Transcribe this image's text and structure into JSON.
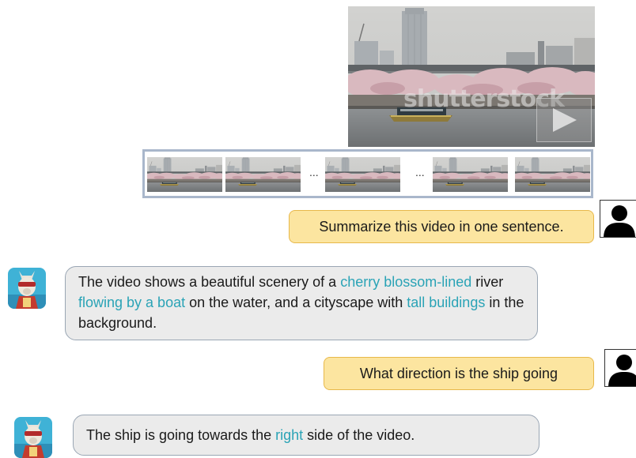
{
  "video": {
    "watermark": "shutterstock",
    "play_icon": "play-icon"
  },
  "frame_strip": {
    "ellipsis_1": "...",
    "ellipsis_2": "..."
  },
  "chat": {
    "turns": [
      {
        "role": "user",
        "text": "Summarize this video in one sentence."
      },
      {
        "role": "assistant",
        "segments": [
          {
            "text": "The video shows a beautiful scenery of a ",
            "highlight": false
          },
          {
            "text": "cherry blossom-lined",
            "highlight": true
          },
          {
            "text": " river ",
            "highlight": false
          },
          {
            "text": "flowing by a boat",
            "highlight": true
          },
          {
            "text": " on the water, and a cityscape with ",
            "highlight": false
          },
          {
            "text": "tall buildings",
            "highlight": true
          },
          {
            "text": " in the background.",
            "highlight": false
          }
        ]
      },
      {
        "role": "user",
        "text": "What direction is the ship going"
      },
      {
        "role": "assistant",
        "segments": [
          {
            "text": "The ship is going towards the ",
            "highlight": false
          },
          {
            "text": "right",
            "highlight": true
          },
          {
            "text": " side of the video.",
            "highlight": false
          }
        ]
      }
    ]
  },
  "colors": {
    "user_bubble": "#fce5a0",
    "user_bubble_border": "#e8b84a",
    "assistant_bubble": "#ebebeb",
    "highlight": "#2aa3b6",
    "strip_border": "#a9b7cb"
  },
  "icons": {
    "user": "person-silhouette-icon",
    "assistant": "llama-avatar-icon"
  }
}
